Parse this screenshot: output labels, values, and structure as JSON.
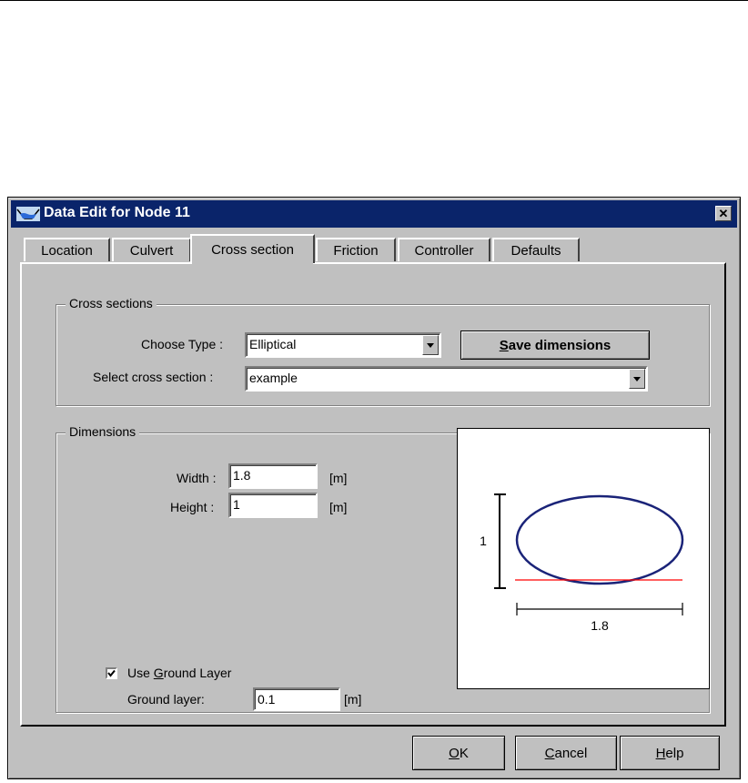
{
  "dialog": {
    "title": "Data Edit for Node 11",
    "close_glyph": "✕"
  },
  "tabs": [
    {
      "label": "Location"
    },
    {
      "label": "Culvert"
    },
    {
      "label": "Cross section",
      "active": true
    },
    {
      "label": "Friction"
    },
    {
      "label": "Controller"
    },
    {
      "label": "Defaults"
    }
  ],
  "cross_sections": {
    "group_label": "Cross sections",
    "choose_type_label": "Choose Type :",
    "choose_type_value": "Elliptical",
    "save_button": {
      "mnemonic": "S",
      "rest": "ave dimensions"
    },
    "select_label": "Select cross section :",
    "select_value": "example"
  },
  "dimensions": {
    "group_label": "Dimensions",
    "width_label": "Width :",
    "width_value": "1.8",
    "width_unit": "[m]",
    "height_label": "Height :",
    "height_value": "1",
    "height_unit": "[m]",
    "use_ground_layer": {
      "checked": true,
      "pre": "Use ",
      "mnemonic": "G",
      "rest": "round Layer"
    },
    "ground_layer_label": "Ground layer:",
    "ground_layer_value": "0.1",
    "ground_layer_unit": "[m]"
  },
  "preview": {
    "shape": "ellipse",
    "height_label": "1",
    "width_label": "1.8",
    "outline_color": "#1a2378",
    "ground_line_color": "#ff0000"
  },
  "buttons": {
    "ok": {
      "mnemonic": "O",
      "rest": "K"
    },
    "cancel": {
      "mnemonic": "C",
      "rest": "ancel"
    },
    "help": {
      "mnemonic": "H",
      "rest": "elp"
    }
  },
  "icons": {
    "window_icon": "water-channel-icon",
    "dropdown_arrow": "chevron-down-icon",
    "checkmark": "checkmark-icon"
  }
}
